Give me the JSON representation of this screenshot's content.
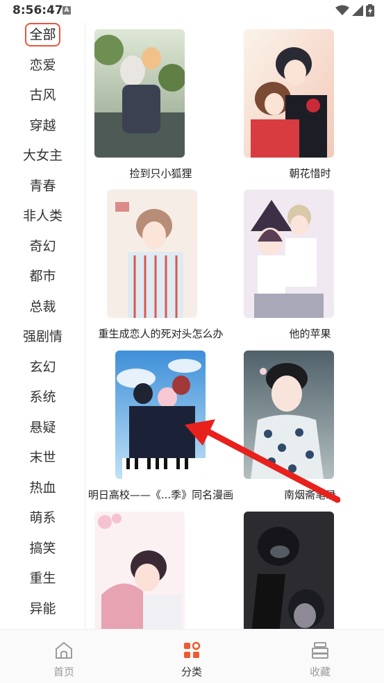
{
  "status_bar": {
    "time": "8:56:47",
    "notification_letter": "A"
  },
  "sidebar": {
    "categories": [
      "全部",
      "恋爱",
      "古风",
      "穿越",
      "大女主",
      "青春",
      "非人类",
      "奇幻",
      "都市",
      "总裁",
      "强剧情",
      "玄幻",
      "系统",
      "悬疑",
      "末世",
      "热血",
      "萌系",
      "搞笑",
      "重生",
      "异能"
    ],
    "active": "全部"
  },
  "comics": [
    {
      "title": "捡到只小狐狸",
      "cover": "cover-fox"
    },
    {
      "title": "朝花惜时",
      "cover": "cover-flowers"
    },
    {
      "title": "重生成恋人的死对头怎么办",
      "cover": "cover-rival"
    },
    {
      "title": "他的苹果",
      "cover": "cover-apple"
    },
    {
      "title": "明日高校——《...季》同名漫画",
      "cover": "cover-school"
    },
    {
      "title": "南烟斋笔录",
      "cover": "cover-nanyan"
    },
    {
      "title": "",
      "cover": "cover-kiss"
    },
    {
      "title": "",
      "cover": "cover-dark"
    }
  ],
  "bottom_nav": {
    "home": "首页",
    "category": "分类",
    "favorites": "收藏"
  },
  "colors": {
    "accent": "#ee5a2f",
    "active_border": "#e8553d",
    "arrow": "#e8211c"
  }
}
